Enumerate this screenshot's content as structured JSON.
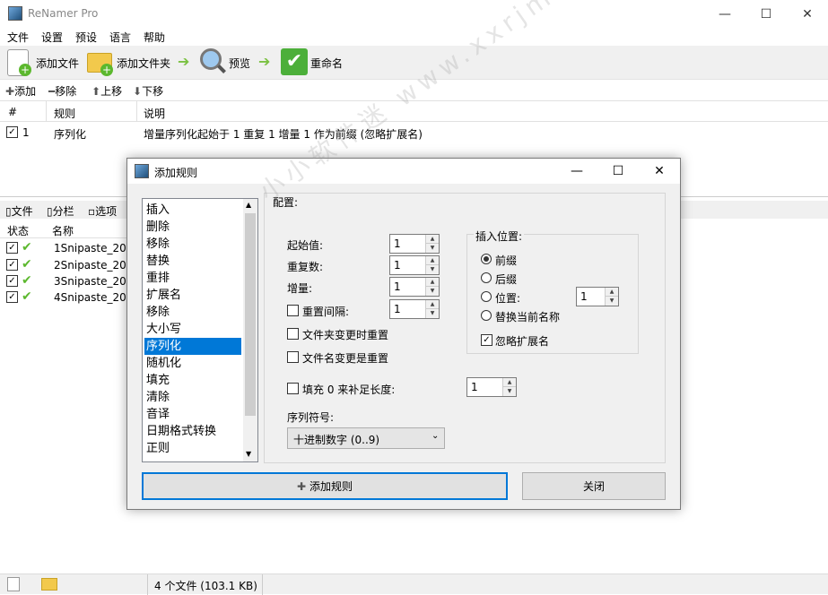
{
  "app": {
    "title": "ReNamer Pro",
    "min": "—",
    "max": "☐",
    "close": "✕"
  },
  "menu": [
    "文件",
    "设置",
    "预设",
    "语言",
    "帮助"
  ],
  "toolbar": {
    "add_files": "添加文件",
    "add_folder": "添加文件夹",
    "preview": "预览",
    "rename": "重命名"
  },
  "rule_toolbar": {
    "add": "添加",
    "remove": "移除",
    "move_up": "上移",
    "move_down": "下移"
  },
  "rules_table": {
    "headers": [
      "#",
      "规则",
      "说明"
    ],
    "rows": [
      {
        "index": "1",
        "rule": "序列化",
        "desc": "增量序列化起始于 1 重复 1 增量 1 作为前缀 (忽略扩展名)",
        "checked": true
      }
    ]
  },
  "file_tabs": {
    "files": "文件",
    "columns": "分栏",
    "options": "选项"
  },
  "files_table": {
    "headers": [
      "状态",
      "名称"
    ],
    "rows": [
      "1Snipaste_202",
      "2Snipaste_202",
      "3Snipaste_202",
      "4Snipaste_202"
    ]
  },
  "status": {
    "text": "4 个文件 (103.1 KB)"
  },
  "watermark": "小小软件迷 www.xxrjm.com",
  "dialog": {
    "title": "添加规则",
    "rule_list": [
      "插入",
      "删除",
      "移除",
      "替换",
      "重排",
      "扩展名",
      "移除",
      "大小写",
      "序列化",
      "随机化",
      "填充",
      "清除",
      "音译",
      "日期格式转换",
      "正则"
    ],
    "selected_index": 8,
    "config_label": "配置:",
    "start_label": "起始值:",
    "start_value": "1",
    "repeat_label": "重复数:",
    "repeat_value": "1",
    "step_label": "增量:",
    "step_value": "1",
    "reset_every_label": "重置间隔:",
    "reset_every_value": "1",
    "reset_folder_label": "文件夹变更时重置",
    "reset_name_label": "文件名变更是重置",
    "pad_label": "填充 0 来补足长度:",
    "pad_value": "1",
    "seq_label": "序列符号:",
    "seq_value": "十进制数字 (0..9)",
    "insert_title": "插入位置:",
    "prefix": "前缀",
    "suffix": "后缀",
    "position": "位置:",
    "position_value": "1",
    "replace_name": "替换当前名称",
    "ignore_ext": "忽略扩展名",
    "add_rule_button": "添加规则",
    "close_button": "关闭"
  }
}
